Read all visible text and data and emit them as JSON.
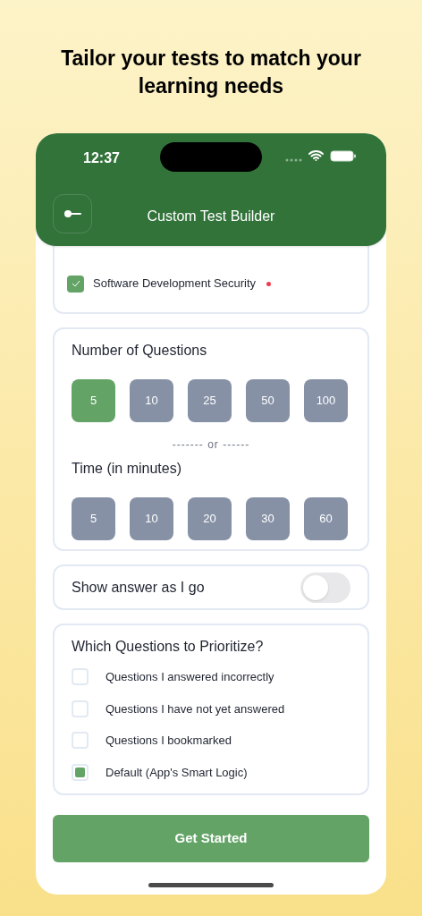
{
  "headline": "Tailor your tests to match your learning needs",
  "status_bar": {
    "time": "12:37"
  },
  "header": {
    "title": "Custom Test Builder"
  },
  "topics": [
    {
      "label": "Software Development Security",
      "checked": true,
      "color": "#ef3b4f"
    }
  ],
  "questions": {
    "title": "Number of Questions",
    "options": [
      {
        "label": "5",
        "selected": true
      },
      {
        "label": "10",
        "selected": false
      },
      {
        "label": "25",
        "selected": false
      },
      {
        "label": "50",
        "selected": false
      },
      {
        "label": "100",
        "selected": false
      }
    ]
  },
  "separator": "------- or ------",
  "time": {
    "title": "Time (in minutes)",
    "options": [
      {
        "label": "5",
        "selected": false
      },
      {
        "label": "10",
        "selected": false
      },
      {
        "label": "20",
        "selected": false
      },
      {
        "label": "30",
        "selected": false
      },
      {
        "label": "60",
        "selected": false
      }
    ]
  },
  "show_answer": {
    "label": "Show answer as I go",
    "on": false
  },
  "priority": {
    "title": "Which Questions to Prioritize?",
    "options": [
      {
        "label": "Questions I answered incorrectly",
        "checked": false
      },
      {
        "label": "Questions I have not yet answered",
        "checked": false
      },
      {
        "label": "Questions I bookmarked",
        "checked": false
      },
      {
        "label": "Default (App's Smart Logic)",
        "checked": true
      }
    ]
  },
  "button": "Get Started"
}
